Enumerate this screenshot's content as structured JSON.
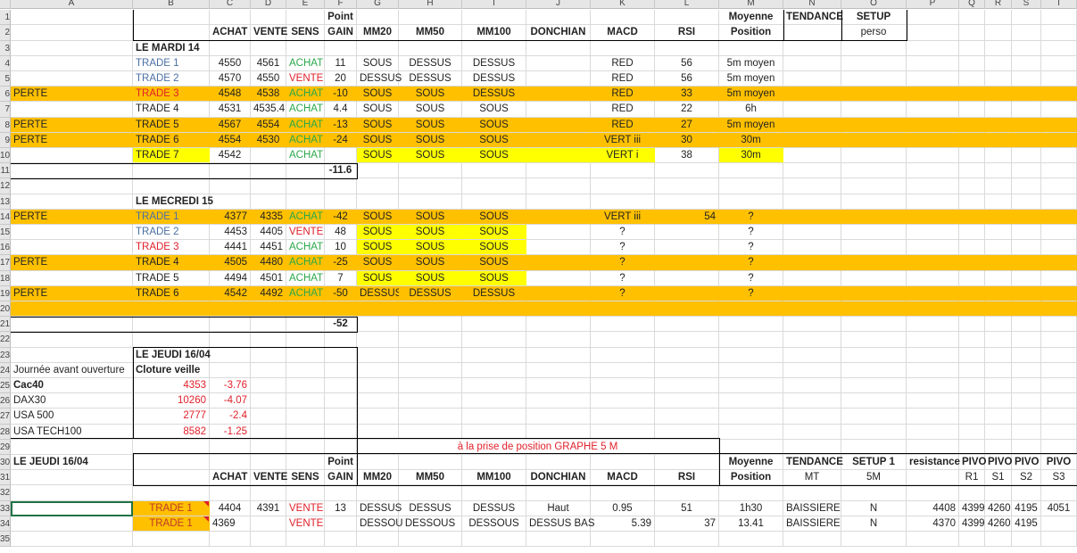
{
  "columns": [
    "A",
    "B",
    "C",
    "D",
    "E",
    "F",
    "G",
    "H",
    "I",
    "J",
    "K",
    "L",
    "M",
    "N",
    "O",
    "P",
    "Q",
    "R",
    "S",
    "T"
  ],
  "colors": {
    "orange": "#ffc000",
    "yellow": "#ffff00",
    "red": "#e0202a",
    "green": "#2aa84a",
    "blue": "#4a6fa5"
  },
  "row_fills": {
    "6": "or",
    "8": "or",
    "9": "or",
    "14": "or",
    "17": "or",
    "19": "or",
    "20": "or"
  },
  "cells": {
    "1": [
      [
        "F",
        "Point",
        "b c"
      ],
      [
        "M",
        "Moyenne",
        "b c"
      ],
      [
        "N",
        "TENDANCE",
        "b c"
      ],
      [
        "O",
        "SETUP",
        "b c"
      ]
    ],
    "2": [
      [
        "C",
        "ACHAT",
        "b c"
      ],
      [
        "D",
        "VENTE",
        "b c"
      ],
      [
        "E",
        "SENS",
        "b c"
      ],
      [
        "F",
        "GAIN",
        "b c"
      ],
      [
        "G",
        "MM20",
        "b c"
      ],
      [
        "H",
        "MM50",
        "b c"
      ],
      [
        "I",
        "MM100",
        "b c"
      ],
      [
        "J",
        "DONCHIAN",
        "b c"
      ],
      [
        "K",
        "MACD",
        "b c"
      ],
      [
        "L",
        "RSI",
        "b c"
      ],
      [
        "M",
        "Position",
        "b c"
      ],
      [
        "O",
        "perso",
        "c"
      ]
    ],
    "3": [
      [
        "B",
        "LE MARDI 14",
        "b l"
      ]
    ],
    "4": [
      [
        "B",
        "TRADE 1",
        "l blue"
      ],
      [
        "C",
        "4550",
        "c"
      ],
      [
        "D",
        "4561",
        "c"
      ],
      [
        "E",
        "ACHAT",
        "c green"
      ],
      [
        "F",
        "11",
        "c"
      ],
      [
        "G",
        "SOUS",
        "c"
      ],
      [
        "H",
        "DESSUS",
        "c"
      ],
      [
        "I",
        "DESSUS",
        "c"
      ],
      [
        "K",
        "RED",
        "c"
      ],
      [
        "L",
        "56",
        "c"
      ],
      [
        "M",
        "5m moyen",
        "c"
      ]
    ],
    "5": [
      [
        "B",
        "TRADE 2",
        "l blue"
      ],
      [
        "C",
        "4570",
        "c"
      ],
      [
        "D",
        "4550",
        "c"
      ],
      [
        "E",
        "VENTE",
        "c red"
      ],
      [
        "F",
        "20",
        "c"
      ],
      [
        "G",
        "DESSUS",
        "c"
      ],
      [
        "H",
        "DESSUS",
        "c"
      ],
      [
        "I",
        "DESSUS",
        "c"
      ],
      [
        "K",
        "RED",
        "c"
      ],
      [
        "L",
        "56",
        "c"
      ],
      [
        "M",
        "5m moyen",
        "c"
      ]
    ],
    "6": [
      [
        "A",
        "PERTE",
        "l"
      ],
      [
        "B",
        "TRADE 3",
        "l red"
      ],
      [
        "C",
        "4548",
        "c"
      ],
      [
        "D",
        "4538",
        "c"
      ],
      [
        "E",
        "ACHAT",
        "c green"
      ],
      [
        "F",
        "-10",
        "c"
      ],
      [
        "G",
        "SOUS",
        "c"
      ],
      [
        "H",
        "SOUS",
        "c"
      ],
      [
        "I",
        "DESSUS",
        "c"
      ],
      [
        "K",
        "RED",
        "c"
      ],
      [
        "L",
        "33",
        "c"
      ],
      [
        "M",
        "5m moyen",
        "c"
      ]
    ],
    "7": [
      [
        "B",
        "TRADE 4",
        "l"
      ],
      [
        "C",
        "4531",
        "c"
      ],
      [
        "D",
        "4535.4",
        "c"
      ],
      [
        "E",
        "ACHAT",
        "c green"
      ],
      [
        "F",
        "4.4",
        "c"
      ],
      [
        "G",
        "SOUS",
        "c"
      ],
      [
        "H",
        "SOUS",
        "c"
      ],
      [
        "I",
        "SOUS",
        "c"
      ],
      [
        "K",
        "RED",
        "c"
      ],
      [
        "L",
        "22",
        "c"
      ],
      [
        "M",
        "6h",
        "c"
      ]
    ],
    "8": [
      [
        "A",
        "PERTE",
        "l"
      ],
      [
        "B",
        "TRADE 5",
        "l"
      ],
      [
        "C",
        "4567",
        "c"
      ],
      [
        "D",
        "4554",
        "c"
      ],
      [
        "E",
        "ACHAT",
        "c green"
      ],
      [
        "F",
        "-13",
        "c"
      ],
      [
        "G",
        "SOUS",
        "c"
      ],
      [
        "H",
        "SOUS",
        "c"
      ],
      [
        "I",
        "SOUS",
        "c"
      ],
      [
        "K",
        "RED",
        "c"
      ],
      [
        "L",
        "27",
        "c"
      ],
      [
        "M",
        "5m moyen",
        "c"
      ]
    ],
    "9": [
      [
        "A",
        "PERTE",
        "l"
      ],
      [
        "B",
        "TRADE 6",
        "l"
      ],
      [
        "C",
        "4554",
        "c"
      ],
      [
        "D",
        "4530",
        "c"
      ],
      [
        "E",
        "ACHAT",
        "c green"
      ],
      [
        "F",
        "-24",
        "c"
      ],
      [
        "G",
        "SOUS",
        "c"
      ],
      [
        "H",
        "SOUS",
        "c"
      ],
      [
        "I",
        "SOUS",
        "c"
      ],
      [
        "K",
        "VERT iii",
        "c"
      ],
      [
        "L",
        "30",
        "c"
      ],
      [
        "M",
        "30m",
        "c"
      ]
    ],
    "10": [
      [
        "B",
        "TRADE 7",
        "l yl"
      ],
      [
        "C",
        "4542",
        "c"
      ],
      [
        "E",
        "ACHAT",
        "c green"
      ],
      [
        "G",
        "SOUS",
        "c yl"
      ],
      [
        "H",
        "SOUS",
        "c yl"
      ],
      [
        "I",
        "SOUS",
        "c yl"
      ],
      [
        "J",
        "",
        "yl"
      ],
      [
        "K",
        "VERT i",
        "c yl"
      ],
      [
        "L",
        "38",
        "c"
      ],
      [
        "M",
        "30m",
        "c yl"
      ]
    ],
    "11": [
      [
        "F",
        "-11.6",
        "b c"
      ]
    ],
    "13": [
      [
        "B",
        "LE MECREDI 15",
        "b l"
      ]
    ],
    "14": [
      [
        "A",
        "PERTE",
        "l"
      ],
      [
        "B",
        "TRADE 1",
        "l blue"
      ],
      [
        "C",
        "4377",
        "r"
      ],
      [
        "D",
        "4335",
        "r"
      ],
      [
        "E",
        "ACHAT",
        "c green"
      ],
      [
        "F",
        "-42",
        "c"
      ],
      [
        "G",
        "SOUS",
        "c"
      ],
      [
        "H",
        "SOUS",
        "c"
      ],
      [
        "I",
        "SOUS",
        "c"
      ],
      [
        "K",
        "VERT iii",
        "c"
      ],
      [
        "L",
        "54",
        "r"
      ],
      [
        "M",
        "?",
        "c"
      ]
    ],
    "15": [
      [
        "B",
        "TRADE 2",
        "l blue"
      ],
      [
        "C",
        "4453",
        "r"
      ],
      [
        "D",
        "4405",
        "r"
      ],
      [
        "E",
        "VENTE",
        "c red"
      ],
      [
        "F",
        "48",
        "c"
      ],
      [
        "G",
        "SOUS",
        "c yl"
      ],
      [
        "H",
        "SOUS",
        "c yl"
      ],
      [
        "I",
        "SOUS",
        "c yl"
      ],
      [
        "K",
        "?",
        "c"
      ],
      [
        "M",
        "?",
        "c"
      ]
    ],
    "16": [
      [
        "B",
        "TRADE 3",
        "l red"
      ],
      [
        "C",
        "4441",
        "r"
      ],
      [
        "D",
        "4451",
        "r"
      ],
      [
        "E",
        "ACHAT",
        "c green"
      ],
      [
        "F",
        "10",
        "c"
      ],
      [
        "G",
        "SOUS",
        "c yl"
      ],
      [
        "H",
        "SOUS",
        "c yl"
      ],
      [
        "I",
        "SOUS",
        "c yl"
      ],
      [
        "K",
        "?",
        "c"
      ],
      [
        "M",
        "?",
        "c"
      ]
    ],
    "17": [
      [
        "A",
        "PERTE",
        "l"
      ],
      [
        "B",
        "TRADE 4",
        "l"
      ],
      [
        "C",
        "4505",
        "r"
      ],
      [
        "D",
        "4480",
        "r"
      ],
      [
        "E",
        "ACHAT",
        "c green"
      ],
      [
        "F",
        "-25",
        "c"
      ],
      [
        "G",
        "SOUS",
        "c"
      ],
      [
        "H",
        "SOUS",
        "c"
      ],
      [
        "I",
        "SOUS",
        "c"
      ],
      [
        "K",
        "?",
        "c"
      ],
      [
        "M",
        "?",
        "c"
      ]
    ],
    "18": [
      [
        "B",
        "TRADE 5",
        "l"
      ],
      [
        "C",
        "4494",
        "r"
      ],
      [
        "D",
        "4501",
        "r"
      ],
      [
        "E",
        "ACHAT",
        "c green"
      ],
      [
        "F",
        "7",
        "c"
      ],
      [
        "G",
        "SOUS",
        "c yl"
      ],
      [
        "H",
        "SOUS",
        "c yl"
      ],
      [
        "I",
        "SOUS",
        "c yl"
      ],
      [
        "K",
        "?",
        "c"
      ],
      [
        "M",
        "?",
        "c"
      ]
    ],
    "19": [
      [
        "A",
        "PERTE",
        "l"
      ],
      [
        "B",
        "TRADE 6",
        "l"
      ],
      [
        "C",
        "4542",
        "r"
      ],
      [
        "D",
        "4492",
        "r"
      ],
      [
        "E",
        "ACHAT",
        "c green"
      ],
      [
        "F",
        "-50",
        "c"
      ],
      [
        "G",
        "DESSUS",
        "c"
      ],
      [
        "H",
        "DESSUS",
        "c"
      ],
      [
        "I",
        "DESSUS",
        "c"
      ],
      [
        "K",
        "?",
        "c"
      ],
      [
        "M",
        "?",
        "c"
      ]
    ],
    "21": [
      [
        "F",
        "-52",
        "b c"
      ]
    ],
    "23": [
      [
        "B",
        "LE JEUDI 16/04",
        "b l"
      ]
    ],
    "24": [
      [
        "A",
        "Journée avant ouverture",
        "l"
      ],
      [
        "B",
        "Cloture veille",
        "b l"
      ]
    ],
    "25": [
      [
        "A",
        "Cac40",
        "b l"
      ],
      [
        "B",
        "4353",
        "r red"
      ],
      [
        "C",
        "-3.76",
        "r red"
      ]
    ],
    "26": [
      [
        "A",
        "DAX30",
        "l"
      ],
      [
        "B",
        "10260",
        "r red"
      ],
      [
        "C",
        "-4.07",
        "r red"
      ]
    ],
    "27": [
      [
        "A",
        "USA 500",
        "l"
      ],
      [
        "B",
        "2777",
        "r red"
      ],
      [
        "C",
        "-2.4",
        "r red"
      ]
    ],
    "28": [
      [
        "A",
        "USA TECH100",
        "l"
      ],
      [
        "B",
        "8582",
        "r red"
      ],
      [
        "C",
        "-1.25",
        "r red"
      ]
    ],
    "29": [
      [
        "J",
        "à la prise de position GRAPHE 5 M",
        "c red"
      ]
    ],
    "30": [
      [
        "A",
        "LE JEUDI 16/04",
        "b l"
      ],
      [
        "F",
        "Point",
        "b r"
      ],
      [
        "M",
        "Moyenne",
        "b c"
      ],
      [
        "N",
        "TENDANCE",
        "b c"
      ],
      [
        "O",
        "SETUP 1",
        "b c"
      ],
      [
        "P",
        "resistance",
        "b c"
      ],
      [
        "Q",
        "PIVO",
        "b c"
      ],
      [
        "R",
        "PIVO",
        "b c"
      ],
      [
        "S",
        "PIVO",
        "b c"
      ],
      [
        "T",
        "PIVO",
        "b c"
      ]
    ],
    "31": [
      [
        "C",
        "ACHAT",
        "b c"
      ],
      [
        "D",
        "VENTE",
        "b c"
      ],
      [
        "E",
        "SENS",
        "b c"
      ],
      [
        "F",
        "GAIN",
        "b c"
      ],
      [
        "G",
        "MM20",
        "b c"
      ],
      [
        "H",
        "MM50",
        "b c"
      ],
      [
        "I",
        "MM100",
        "b c"
      ],
      [
        "J",
        "DONCHIAN",
        "b c"
      ],
      [
        "K",
        "MACD",
        "b c"
      ],
      [
        "L",
        "RSI",
        "b c"
      ],
      [
        "M",
        "Position",
        "b c"
      ],
      [
        "N",
        "MT",
        "c"
      ],
      [
        "O",
        "5M",
        "c"
      ],
      [
        "Q",
        "R1",
        "c"
      ],
      [
        "R",
        "S1",
        "c"
      ],
      [
        "S",
        "S2",
        "c"
      ],
      [
        "T",
        "S3",
        "c"
      ]
    ],
    "33": [
      [
        "A",
        "",
        "sel"
      ],
      [
        "B",
        "TRADE 1",
        "c or note"
      ],
      [
        "C",
        "4404",
        "c"
      ],
      [
        "D",
        "4391",
        "c"
      ],
      [
        "E",
        "VENTE",
        "c red"
      ],
      [
        "F",
        "13",
        "c"
      ],
      [
        "G",
        "DESSUS",
        "c"
      ],
      [
        "H",
        "DESSUS",
        "c"
      ],
      [
        "I",
        "DESSUS",
        "c"
      ],
      [
        "J",
        "Haut",
        "c"
      ],
      [
        "K",
        "0.95",
        "c"
      ],
      [
        "L",
        "51",
        "c"
      ],
      [
        "M",
        "1h30",
        "c"
      ],
      [
        "N",
        "BAISSIERE",
        "c"
      ],
      [
        "O",
        "N",
        "c"
      ],
      [
        "P",
        "4408",
        "r"
      ],
      [
        "Q",
        "4399",
        "c"
      ],
      [
        "R",
        "4260",
        "c"
      ],
      [
        "S",
        "4195",
        "c"
      ],
      [
        "T",
        "4051",
        "c"
      ]
    ],
    "34": [
      [
        "B",
        "TRADE 1",
        "c or note"
      ],
      [
        "C",
        "4369",
        "l"
      ],
      [
        "E",
        "VENTE",
        "c red"
      ],
      [
        "G",
        "DESSOU",
        "c"
      ],
      [
        "H",
        "DESSOUS",
        "c"
      ],
      [
        "I",
        "DESSOUS",
        "c"
      ],
      [
        "J",
        "DESSUS BAS",
        "c"
      ],
      [
        "K",
        "5.39",
        "r"
      ],
      [
        "L",
        "37",
        "r"
      ],
      [
        "M",
        "13.41",
        "c"
      ],
      [
        "N",
        "BAISSIERE",
        "c"
      ],
      [
        "O",
        "N",
        "c"
      ],
      [
        "P",
        "4370",
        "r"
      ],
      [
        "Q",
        "4399",
        "c"
      ],
      [
        "R",
        "4260",
        "c"
      ],
      [
        "S",
        "4195",
        "c"
      ]
    ]
  }
}
